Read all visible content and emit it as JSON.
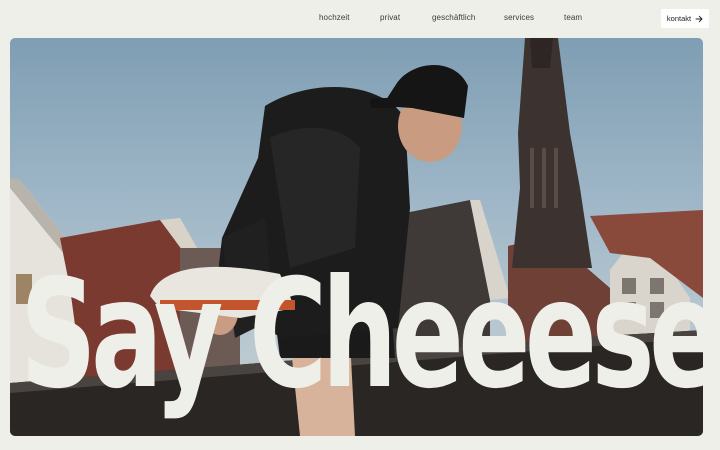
{
  "nav": {
    "items": [
      {
        "label": "hochzeit"
      },
      {
        "label": "privat"
      },
      {
        "label": "geschäftlich"
      },
      {
        "label": "services"
      },
      {
        "label": "team"
      }
    ],
    "cta_label": "kontakt"
  },
  "hero": {
    "headline": "Say Cheeese"
  },
  "icons": {
    "cta_icon": "arrow-right-icon"
  },
  "colors": {
    "page_background": "#efefea",
    "headline": "#efefe9",
    "cta_background": "#ffffff"
  }
}
